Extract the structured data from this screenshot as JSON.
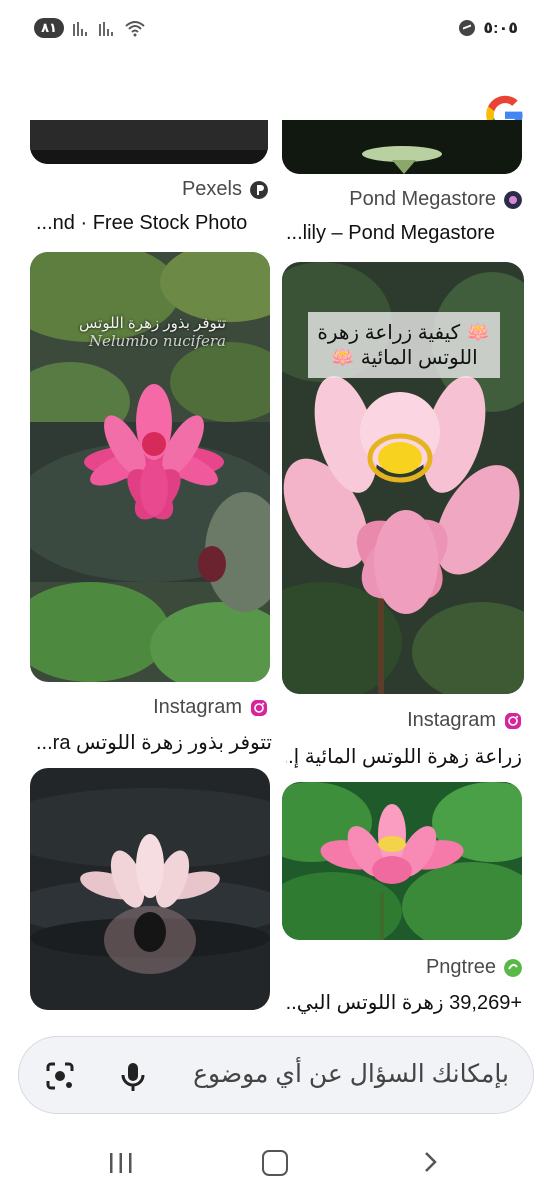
{
  "status_bar": {
    "battery": "٨١",
    "time": "٥:٠٥",
    "icons": [
      "signal-icon",
      "signal-icon",
      "wifi-icon",
      "messenger-icon"
    ]
  },
  "app": {
    "logo": "google-logo"
  },
  "results": [
    {
      "source": "Pexels",
      "source_icon": "pexels-icon",
      "title": "...nd · Free Stock Photo",
      "image": "partially-scrolled"
    },
    {
      "source": "Pond Megastore",
      "source_icon": "pond-megastore-icon",
      "title": "...lily – Pond Megastore",
      "image": "partially-scrolled"
    },
    {
      "image_caption_line1": "تتوفر بذور زهرة اللوتس",
      "image_caption_line2": "Nelumbo nucifera",
      "source": "Instagram",
      "source_icon": "instagram-icon",
      "title": "تتوفر بذور زهرة اللوتس ra..."
    },
    {
      "image_caption_line1": "🪷 كيفية زراعة زهرة",
      "image_caption_line2": "اللوتس المائية 🪷",
      "source": "Instagram",
      "source_icon": "instagram-icon",
      "title": "زراعة زهرة اللوتس المائية إ..."
    },
    {
      "image": "lotus-on-dark-water",
      "source": "",
      "title": ""
    },
    {
      "image": "lotus-among-green-leaves",
      "source": "Pngtree",
      "source_icon": "pngtree-icon",
      "title": "+39,269 زهرة اللوتس البي..."
    }
  ],
  "search": {
    "placeholder": "بإمكانك السؤال عن أي موضوع",
    "icons": [
      "lens-icon",
      "mic-icon"
    ]
  },
  "nav": {
    "icons": [
      "recent-apps-icon",
      "home-icon",
      "back-icon"
    ]
  },
  "colors": {
    "pink_lotus": "#f2559b",
    "light_lotus": "#f5b5c8",
    "leaf_green": "#3f7a3a",
    "instagram": "#d6249f",
    "pngtree": "#58b947"
  }
}
